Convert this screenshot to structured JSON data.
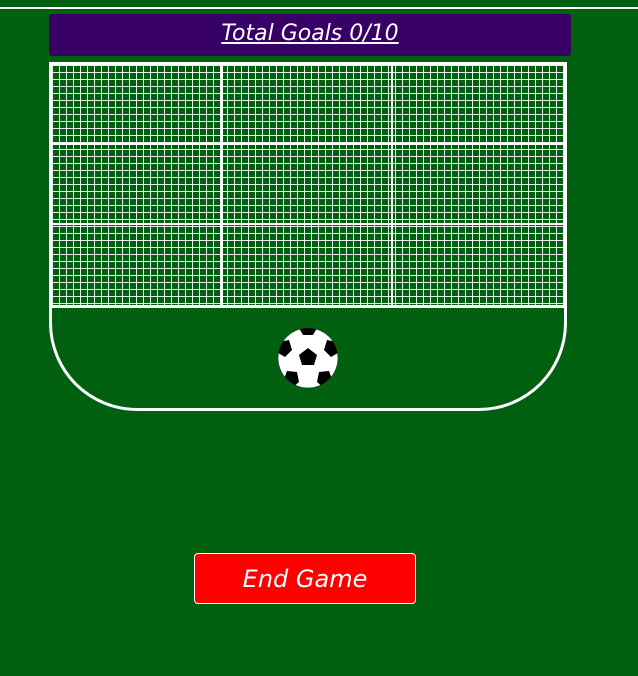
{
  "header": {
    "score_label": "Total Goals 0/10"
  },
  "goal": {
    "zones": [
      "top-left",
      "top-center",
      "top-right",
      "middle-left",
      "middle-center",
      "middle-right",
      "bottom-left",
      "bottom-center",
      "bottom-right"
    ]
  },
  "ball": {
    "icon": "soccer-ball-icon"
  },
  "controls": {
    "end_label": "End Game"
  },
  "colors": {
    "field": "#006010",
    "score_bar": "#380066",
    "end_button": "#ff0000",
    "lines": "#ffffff"
  }
}
